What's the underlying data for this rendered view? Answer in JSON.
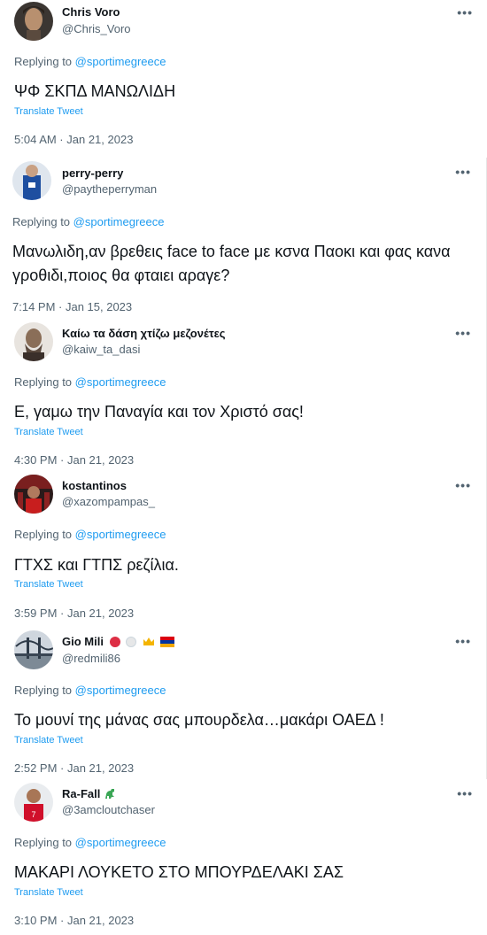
{
  "tweets": [
    {
      "name": "Chris Voro",
      "handle": "@Chris_Voro",
      "replying": "Replying to",
      "reply_to": "@sportimegreece",
      "text": "ΨΦ ΣΚΠΔ ΜΑΝΩΛΙΔΗ",
      "translate": "Translate Tweet",
      "time": "5:04 AM · Jan 21, 2023",
      "more": "•••",
      "avatar": "man-face-avatar"
    },
    {
      "name": "perry-perry",
      "handle": "@paytheperryman",
      "replying": "Replying to",
      "reply_to": "@sportimegreece",
      "text": "Μανωλιδη,αν βρεθεις face to face με κσνα Παοκι και φας κανα γροθιδι,ποιος θα φταιει αραγε?",
      "translate": "",
      "time": "7:14 PM · Jan 15, 2023",
      "more": "•••",
      "avatar": "jersey-avatar"
    },
    {
      "name": "Καίω τα δάση χτίζω μεζονέτες",
      "handle": "@kaiw_ta_dasi",
      "replying": "Replying to",
      "reply_to": "@sportimegreece",
      "text": "Ε, γαμω την Παναγία και τον Χριστό σας!",
      "translate": "Translate Tweet",
      "time": "4:30 PM · Jan 21, 2023",
      "more": "•••",
      "avatar": "bearded-man-avatar"
    },
    {
      "name": "kostantinos",
      "handle": "@xazompampas_",
      "replying": "Replying to",
      "reply_to": "@sportimegreece",
      "text": "ΓΤΧΣ και ΓΤΠΣ ρεζίλια.",
      "translate": "Translate Tweet",
      "time": "3:59 PM · Jan 21, 2023",
      "more": "•••",
      "avatar": "red-crowd-avatar"
    },
    {
      "name": "Gio Mili",
      "handle": "@redmili86",
      "replying": "Replying to",
      "reply_to": "@sportimegreece",
      "text": "Το μουνί της μάνας σας μπουρδελα…μακάρι ΟΑΕΔ !",
      "translate": "Translate Tweet",
      "time": "2:52 PM · Jan 21, 2023",
      "more": "•••",
      "avatar": "bridge-avatar"
    },
    {
      "name": "Ra-Fall",
      "handle": "@3amcloutchaser",
      "replying": "Replying to",
      "reply_to": "@sportimegreece",
      "text": "ΜΑΚΑΡΙ ΛΟΥΚΕΤΟ ΣΤΟ ΜΠΟΥΡΔΕΛΑΚΙ ΣΑΣ",
      "translate": "Translate Tweet",
      "time": "3:10 PM · Jan 21, 2023",
      "more": "•••",
      "avatar": "red-jersey-player-avatar"
    }
  ],
  "colors": {
    "link": "#1d9bf0",
    "muted": "#536471",
    "text": "#0f1419"
  }
}
